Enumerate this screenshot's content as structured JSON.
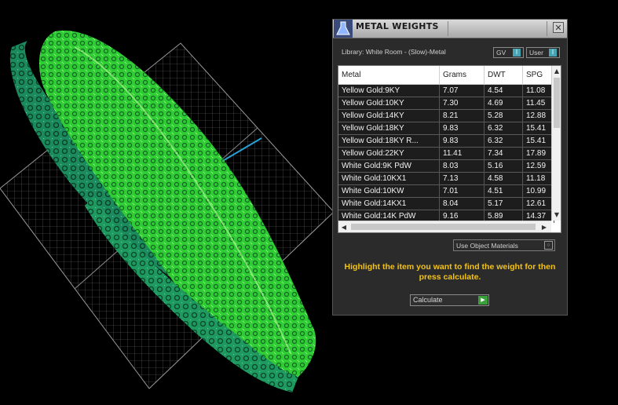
{
  "panel": {
    "title": "METAL WEIGHTS",
    "close_glyph": "✕",
    "logo_icon": "flask-icon",
    "library_label": "Library: White Room - (Slow)-Metal",
    "toggles": {
      "gv": {
        "label": "GV",
        "glyph": "I"
      },
      "user": {
        "label": "User",
        "glyph": "I"
      }
    },
    "table": {
      "columns": [
        "Metal",
        "Grams",
        "DWT",
        "SPG"
      ],
      "rows": [
        [
          "Yellow Gold:9KY",
          "7.07",
          "4.54",
          "11.08"
        ],
        [
          "Yellow Gold:10KY",
          "7.30",
          "4.69",
          "11.45"
        ],
        [
          "Yellow Gold:14KY",
          "8.21",
          "5.28",
          "12.88"
        ],
        [
          "Yellow Gold:18KY",
          "9.83",
          "6.32",
          "15.41"
        ],
        [
          "Yellow Gold:18KY R...",
          "9.83",
          "6.32",
          "15.41"
        ],
        [
          "Yellow Gold:22KY",
          "11.41",
          "7.34",
          "17.89"
        ],
        [
          "White Gold:9K PdW",
          "8.03",
          "5.16",
          "12.59"
        ],
        [
          "White Gold:10KX1",
          "7.13",
          "4.58",
          "11.18"
        ],
        [
          "White Gold:10KW",
          "7.01",
          "4.51",
          "10.99"
        ],
        [
          "White Gold:14KX1",
          "8.04",
          "5.17",
          "12.61"
        ],
        [
          "White Gold:14K PdW",
          "9.16",
          "5.89",
          "14.37"
        ]
      ]
    },
    "use_object_materials": {
      "label": "Use Object Materials",
      "checked": false
    },
    "instructions": "Highlight the item you want to find the weight for then press calculate.",
    "calculate": {
      "label": "Calculate",
      "icon": "play-arrow-icon"
    }
  },
  "colors": {
    "instruction_text": "#f4c316",
    "toggle_accent": "#48a5b3",
    "calculate_icon": "#3aa13a",
    "ring_bright": "#3ee03a",
    "ring_dark": "#1f8a5e"
  }
}
